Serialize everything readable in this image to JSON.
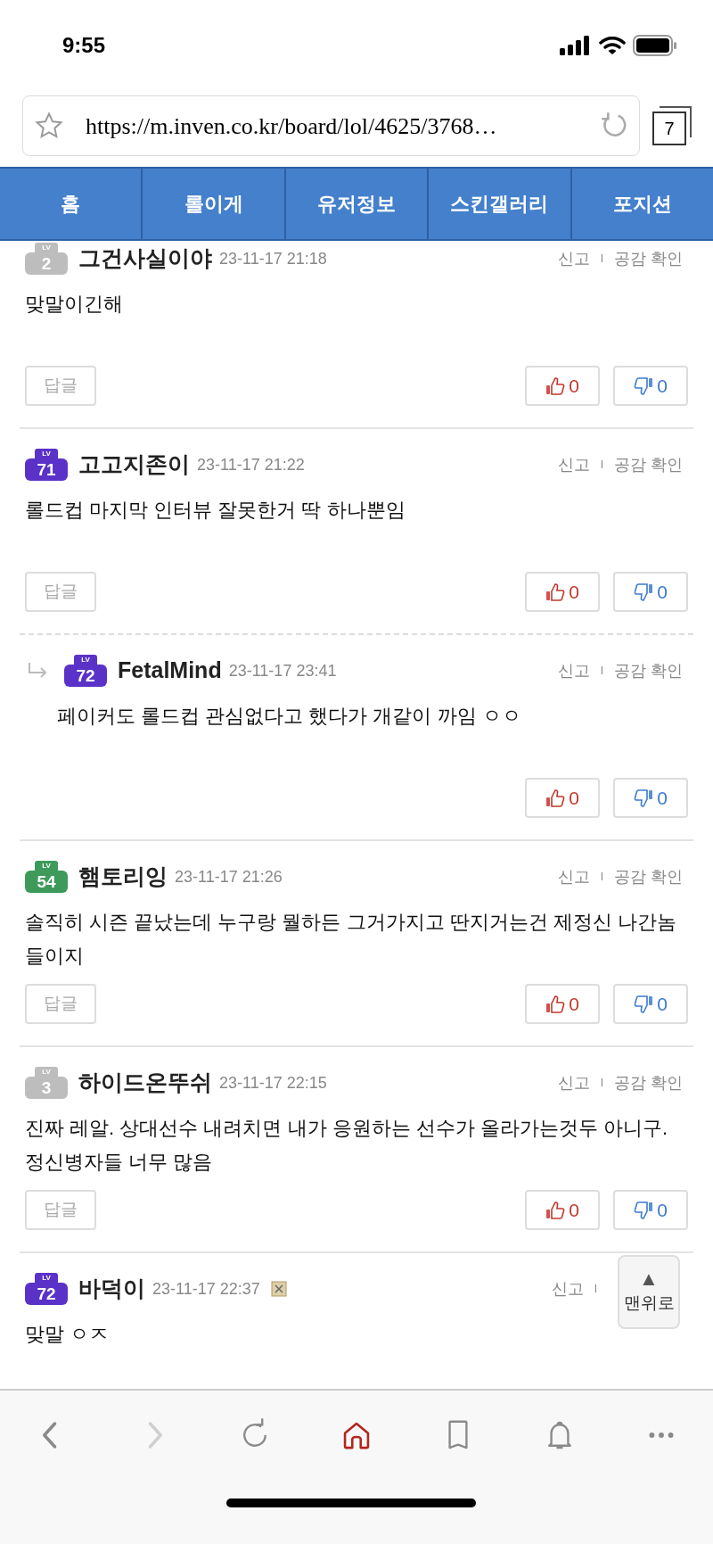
{
  "status_bar": {
    "time": "9:55"
  },
  "browser": {
    "url": "https://m.inven.co.kr/board/lol/4625/3768…",
    "tab_count": "7"
  },
  "nav_tabs": [
    {
      "label": "홈"
    },
    {
      "label": "롤이게"
    },
    {
      "label": "유저정보"
    },
    {
      "label": "스킨갤러리"
    },
    {
      "label": "포지션"
    }
  ],
  "comments": [
    {
      "kind": "comment",
      "badge_label": "LV",
      "level": "2",
      "color": "#bdbdbd",
      "author": "그건사실이야",
      "date": "23-11-17 21:18",
      "report": "신고",
      "separator": "I",
      "likes_check": "공감 확인",
      "body": "맞말이긴해",
      "reply_button": "답글",
      "likes": "0",
      "dislikes": "0"
    },
    {
      "kind": "comment",
      "badge_label": "LV",
      "level": "71",
      "color": "#5b32c8",
      "author": "고고지존이",
      "date": "23-11-17 21:22",
      "report": "신고",
      "separator": "I",
      "likes_check": "공감 확인",
      "body": "롤드컵 마지막 인터뷰 잘못한거 딱 하나뿐임",
      "reply_button": "답글",
      "likes": "0",
      "dislikes": "0"
    },
    {
      "kind": "reply",
      "badge_label": "LV",
      "level": "72",
      "color": "#5b32c8",
      "author": "FetalMind",
      "date": "23-11-17 23:41",
      "report": "신고",
      "separator": "I",
      "likes_check": "공감 확인",
      "body": "페이커도 롤드컵 관심없다고 했다가 개같이 까임 ㅇㅇ",
      "likes": "0",
      "dislikes": "0"
    },
    {
      "kind": "comment",
      "badge_label": "LV",
      "level": "54",
      "color": "#3d9a5a",
      "author": "햄토리잉",
      "date": "23-11-17 21:26",
      "report": "신고",
      "separator": "I",
      "likes_check": "공감 확인",
      "body": "솔직히 시즌 끝났는데 누구랑 뭘하든 그거가지고 딴지거는건 제정신 나간놈들이지",
      "reply_button": "답글",
      "likes": "0",
      "dislikes": "0"
    },
    {
      "kind": "comment",
      "badge_label": "LV",
      "level": "3",
      "color": "#bdbdbd",
      "author": "하이드온뚜쉬",
      "date": "23-11-17 22:15",
      "report": "신고",
      "separator": "I",
      "likes_check": "공감 확인",
      "body": "진짜 레알. 상대선수 내려치면 내가 응원하는 선수가 올라가는것두 아니구. 정신병자들 너무 많음",
      "reply_button": "답글",
      "likes": "0",
      "dislikes": "0"
    },
    {
      "kind": "comment",
      "badge_label": "LV",
      "level": "72",
      "color": "#5b32c8",
      "author": "바덕이",
      "date": "23-11-17 22:37",
      "image_icon": true,
      "report": "신고",
      "separator": "I",
      "body": "맞말 ㅇㅈ"
    }
  ],
  "scroll_top": {
    "arrow": "▲",
    "label": "맨위로"
  },
  "toolbar": [
    {
      "kind": "back",
      "disabled": false,
      "selected": false
    },
    {
      "kind": "forward",
      "disabled": true,
      "selected": false
    },
    {
      "kind": "reload",
      "disabled": false,
      "selected": false
    },
    {
      "kind": "home",
      "disabled": false,
      "selected": true
    },
    {
      "kind": "bookmark",
      "disabled": false,
      "selected": false
    },
    {
      "kind": "bell",
      "disabled": false,
      "selected": false
    },
    {
      "kind": "more",
      "disabled": false,
      "selected": false
    }
  ]
}
